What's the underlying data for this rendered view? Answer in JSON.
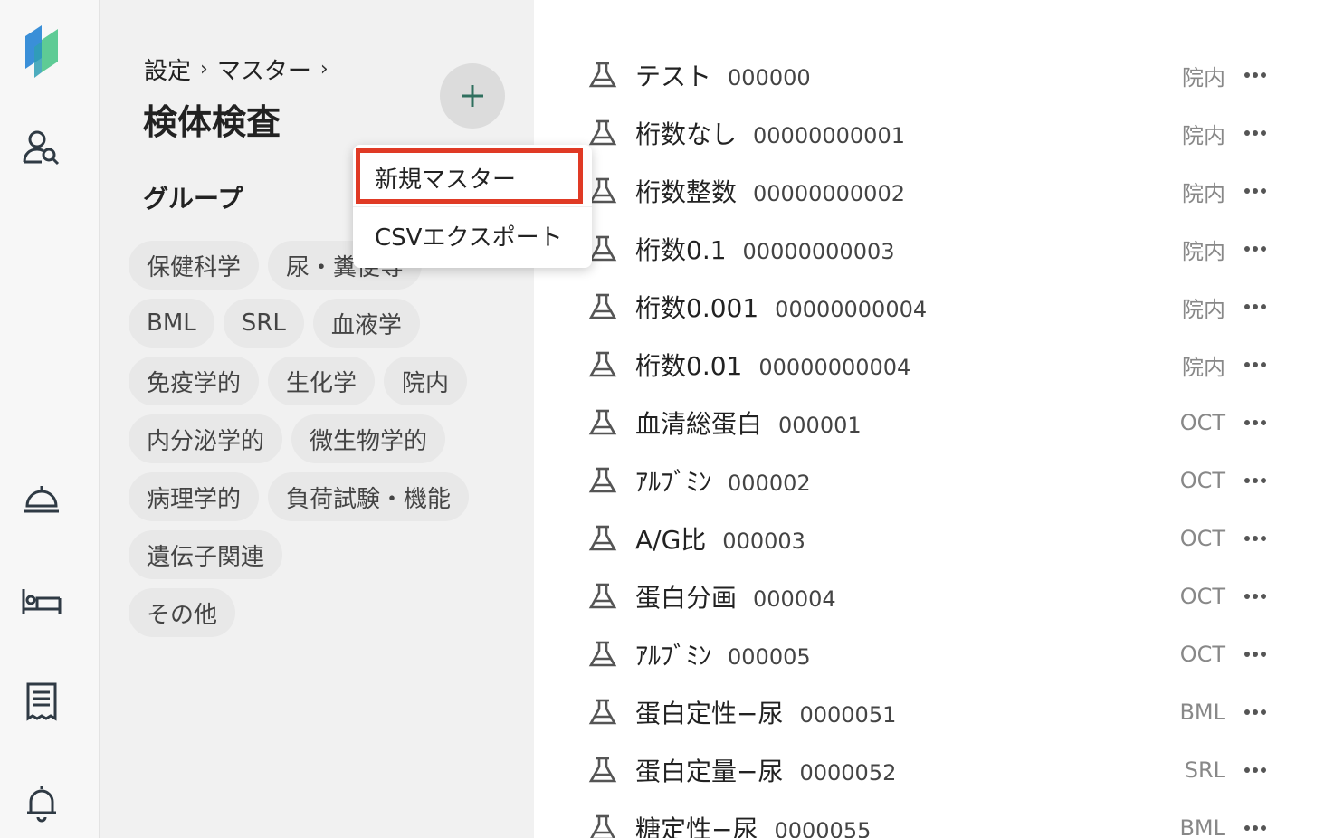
{
  "breadcrumb": {
    "item1": "設定",
    "item2": "マスター",
    "separator": "›"
  },
  "page_title": "検体検査",
  "group_heading": "グループ",
  "chip_rows": [
    [
      "保健科学",
      "尿・糞便等"
    ],
    [
      "BML",
      "SRL",
      "血液学"
    ],
    [
      "免疫学的",
      "生化学",
      "院内"
    ],
    [
      "内分泌学的",
      "微生物学的"
    ],
    [
      "病理学的",
      "負荷試験・機能"
    ],
    [
      "遺伝子関連"
    ],
    [
      "その他"
    ]
  ],
  "menu": {
    "new_master": "新規マスター",
    "csv_export": "CSVエクスポート"
  },
  "list_items": [
    {
      "name": "テスト",
      "code": "000000",
      "badge": "院内"
    },
    {
      "name": "桁数なし",
      "code": "00000000001",
      "badge": "院内"
    },
    {
      "name": "桁数整数",
      "code": "00000000002",
      "badge": "院内"
    },
    {
      "name": "桁数0.1",
      "code": "00000000003",
      "badge": "院内"
    },
    {
      "name": "桁数0.001",
      "code": "00000000004",
      "badge": "院内"
    },
    {
      "name": "桁数0.01",
      "code": "00000000004",
      "badge": "院内"
    },
    {
      "name": "血清総蛋白",
      "code": "000001",
      "badge": "OCT"
    },
    {
      "name": "ｱﾙﾌﾞﾐﾝ",
      "code": "000002",
      "badge": "OCT"
    },
    {
      "name": "A/G比",
      "code": "000003",
      "badge": "OCT"
    },
    {
      "name": "蛋白分画",
      "code": "000004",
      "badge": "OCT"
    },
    {
      "name": "ｱﾙﾌﾞﾐﾝ",
      "code": "000005",
      "badge": "OCT"
    },
    {
      "name": "蛋白定性−尿",
      "code": "0000051",
      "badge": "BML"
    },
    {
      "name": "蛋白定量−尿",
      "code": "0000052",
      "badge": "SRL"
    },
    {
      "name": "糖定性−尿",
      "code": "0000055",
      "badge": "BML"
    }
  ],
  "rail_icons": [
    "app-logo",
    "patient-search-icon",
    "meal-cloche-icon",
    "bed-icon",
    "receipt-icon",
    "bell-icon"
  ],
  "colors": {
    "accent": "#2f6f5e",
    "highlight": "#e03a25",
    "logo_blue": "#3a8fd8",
    "logo_green": "#4cc58a"
  }
}
